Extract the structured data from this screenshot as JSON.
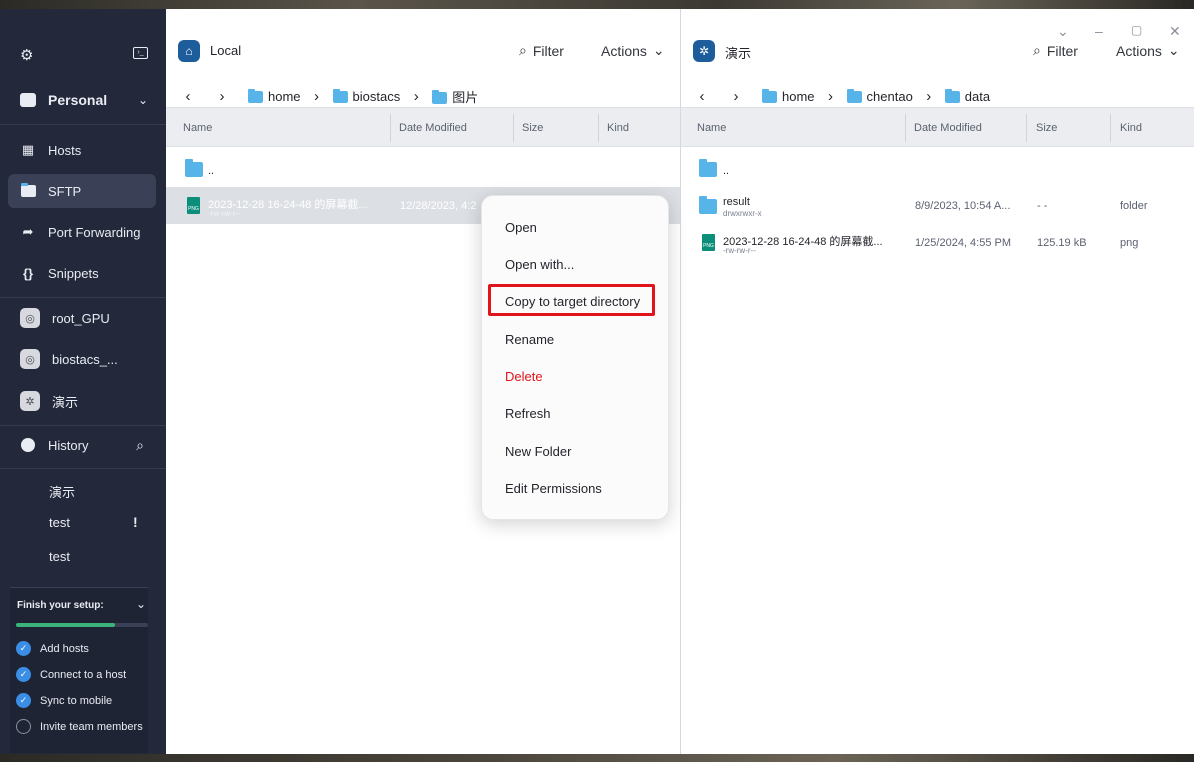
{
  "sidebar": {
    "vault": "Personal",
    "nav": [
      "Hosts",
      "SFTP",
      "Port Forwarding",
      "Snippets"
    ],
    "hosts": [
      "root_GPU",
      "biostacs_...",
      "演示"
    ],
    "history_label": "History",
    "history_items": [
      "演示",
      "test",
      "test"
    ],
    "history_alert": "!",
    "setup": {
      "title": "Finish your setup:",
      "progress": 0.75,
      "items": [
        "Add hosts",
        "Connect to a host",
        "Sync to mobile",
        "Invite team members"
      ],
      "done": [
        true,
        true,
        true,
        false
      ]
    }
  },
  "left": {
    "title": "Local",
    "filter": "Filter",
    "actions": "Actions",
    "crumbs": [
      "home",
      "biostacs",
      "图片"
    ],
    "columns": [
      "Name",
      "Date Modified",
      "Size",
      "Kind"
    ],
    "parent": "..",
    "file": {
      "name": "2023-12-28 16-24-48 的屏幕截...",
      "perm": "-rw-rw-r--",
      "date": "12/28/2023, 4:2"
    }
  },
  "right": {
    "title": "演示",
    "filter": "Filter",
    "actions": "Actions",
    "crumbs": [
      "home",
      "chentao",
      "data"
    ],
    "columns": [
      "Name",
      "Date Modified",
      "Size",
      "Kind"
    ],
    "parent": "..",
    "rows": [
      {
        "name": "result",
        "perm": "drwxrwxr-x",
        "date": "8/9/2023, 10:54 A...",
        "size": "- -",
        "kind": "folder"
      },
      {
        "name": "2023-12-28 16-24-48 的屏幕截...",
        "perm": "-rw-rw-r--",
        "date": "1/25/2024, 4:55 PM",
        "size": "125.19 kB",
        "kind": "png"
      }
    ]
  },
  "context_menu": {
    "items": [
      "Open",
      "Open with...",
      "Copy to target directory",
      "Rename",
      "Delete",
      "Refresh",
      "New Folder",
      "Edit Permissions"
    ],
    "highlighted": "Copy to target directory",
    "danger_color": "#e0141a"
  },
  "colors": {
    "sidebar": "#23283a",
    "accent": "#1e5d9b",
    "folder": "#56b4e9",
    "highlight_box": "#e0141a",
    "progress": "#3bb37a"
  }
}
